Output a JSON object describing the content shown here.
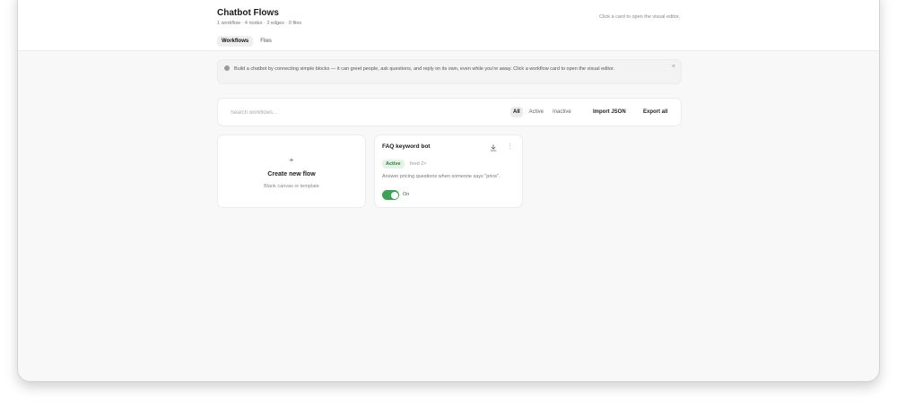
{
  "header": {
    "title": "Chatbot Flows",
    "subtitle": "1 workflow · 4 nodes · 3 edges · 0 files",
    "hint": "Click a card to open the visual editor.",
    "tabs": [
      {
        "label": "Workflows",
        "active": true
      },
      {
        "label": "Files",
        "active": false
      }
    ]
  },
  "banner": {
    "text": "Build a chatbot by connecting simple blocks — it can greet people, ask questions, and reply on its own, even while you're away. Click a workflow card to open the visual editor.",
    "close": "×"
  },
  "toolbar": {
    "search_placeholder": "Search workflows...",
    "filters": [
      {
        "label": "All",
        "active": true
      },
      {
        "label": "Active",
        "active": false
      },
      {
        "label": "Inactive",
        "active": false
      }
    ],
    "import_label": "Import JSON",
    "export_label": "Export all"
  },
  "new_flow_card": {
    "icon": "+",
    "title": "Create new flow",
    "subtitle": "Blank canvas or template"
  },
  "workflows": [
    {
      "name": "FAQ keyword bot",
      "status": "Active",
      "fired": "fired 2×",
      "description": "Answer pricing questions when someone says \"price\".",
      "enabled": true,
      "toggle_label": "On",
      "more": "⋮"
    }
  ],
  "colors": {
    "accent_green": "#3aa356",
    "badge_bg": "#e4f3e7",
    "background": "#f8f8f8"
  }
}
